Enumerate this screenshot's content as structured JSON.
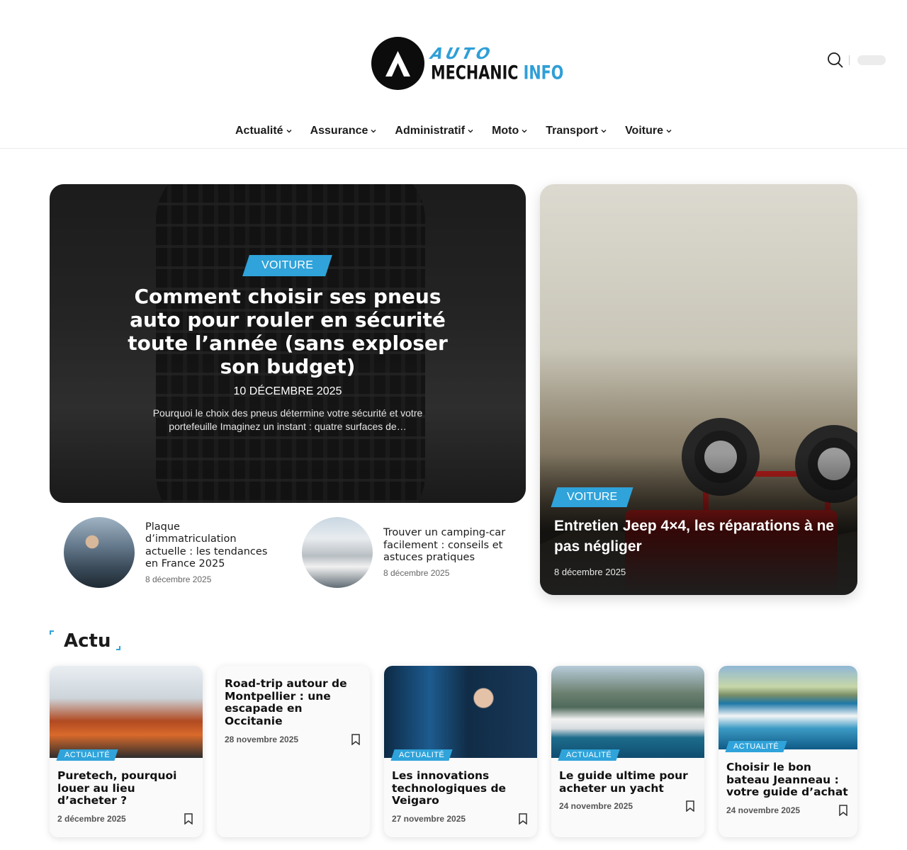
{
  "header": {
    "logo": {
      "top": "AUTO",
      "bottom_a": "MECHANIC",
      "bottom_b": "INFO"
    },
    "search_icon": "search-icon"
  },
  "nav": [
    {
      "label": "Actualité"
    },
    {
      "label": "Assurance"
    },
    {
      "label": "Administratif"
    },
    {
      "label": "Moto"
    },
    {
      "label": "Transport"
    },
    {
      "label": "Voiture"
    }
  ],
  "hero": {
    "main": {
      "category": "VOITURE",
      "title": "Comment choisir ses pneus auto pour rouler en sécurité toute l’année (sans exploser son budget)",
      "date": "10 DÉCEMBRE 2025",
      "excerpt": "Pourquoi le choix des pneus détermine votre sécurité et votre portefeuille Imaginez un instant : quatre surfaces de…"
    },
    "side": {
      "category": "VOITURE",
      "title": "Entretien Jeep 4×4, les réparations à ne pas négliger",
      "date": "8 décembre 2025"
    }
  },
  "mini_posts": [
    {
      "title": "Plaque d’immatriculation actuelle : les tendances en France 2025",
      "date": "8 décembre 2025"
    },
    {
      "title": "Trouver un camping-car facilement : conseils et astuces pratiques",
      "date": "8 décembre 2025"
    }
  ],
  "section": {
    "title": "Actu"
  },
  "cards": [
    {
      "category": "ACTUALITÉ",
      "title": "Puretech, pourquoi louer au lieu d’acheter ?",
      "date": "2 décembre 2025"
    },
    {
      "category": "",
      "title": "Road-trip autour de Montpellier : une escapade en Occitanie",
      "date": "28 novembre 2025"
    },
    {
      "category": "ACTUALITÉ",
      "title": "Les innovations technologiques de Veigaro",
      "date": "27 novembre 2025"
    },
    {
      "category": "ACTUALITÉ",
      "title": "Le guide ultime pour acheter un yacht",
      "date": "24 novembre 2025"
    },
    {
      "category": "ACTUALITÉ",
      "title": "Choisir le bon bateau Jeanneau : votre guide d’achat",
      "date": "24 novembre 2025"
    }
  ],
  "colors": {
    "accent": "#2fa3da",
    "dark": "#111111"
  }
}
